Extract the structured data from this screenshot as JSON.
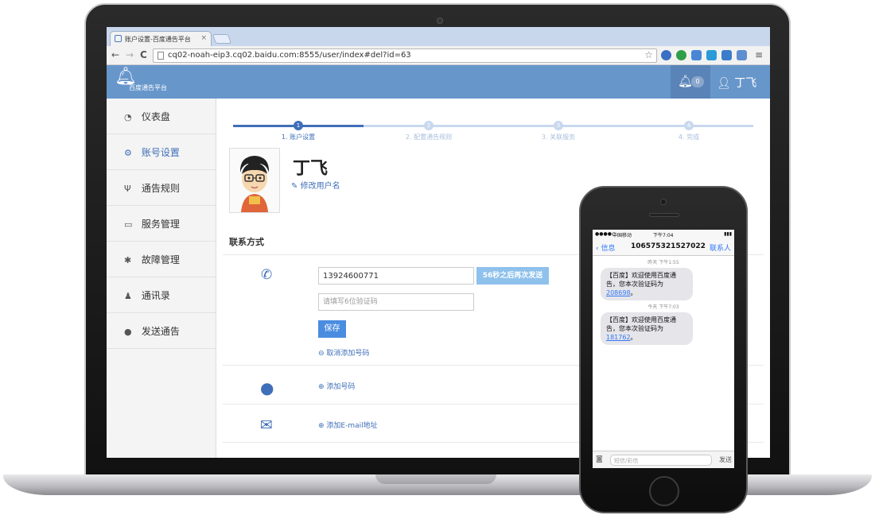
{
  "browser": {
    "tab_title": "账户设置-百度通告平台",
    "tab_close": "×",
    "url": "cq02-noah-eip3.cq02.baidu.com:8555/user/index#del?id=63",
    "nav_back": "←",
    "nav_forward": "→",
    "nav_reload": "C",
    "star": "☆"
  },
  "header": {
    "logo_text": "百度通告平台",
    "notification_count": "0",
    "user_name": "丁飞"
  },
  "sidebar": {
    "items": [
      {
        "label": "仪表盘",
        "icon": "dashboard-icon"
      },
      {
        "label": "账号设置",
        "icon": "cogs-icon"
      },
      {
        "label": "通告规则",
        "icon": "cutlery-icon"
      },
      {
        "label": "服务管理",
        "icon": "inbox-icon"
      },
      {
        "label": "故障管理",
        "icon": "bug-icon"
      },
      {
        "label": "通讯录",
        "icon": "users-icon"
      },
      {
        "label": "发送通告",
        "icon": "comment-icon"
      }
    ],
    "active_index": 1
  },
  "steps": [
    {
      "label": "1. 账户设置",
      "num": "1"
    },
    {
      "label": "2. 配置通告规则",
      "num": "2"
    },
    {
      "label": "3. 关联服务",
      "num": "3"
    },
    {
      "label": "4. 完成",
      "num": "4"
    }
  ],
  "profile": {
    "name": "丁飞",
    "edit_name": "修改用户名"
  },
  "contact": {
    "section_title": "联系方式",
    "phone_value": "13924600771",
    "resend_label": "56秒之后再次发送",
    "code_placeholder": "请填写6位验证码",
    "save_label": "保存",
    "cancel_add_phone": "取消添加号码",
    "add_number": "添加号码",
    "add_email": "添加E-mail地址"
  },
  "phone": {
    "carrier": "中国移动",
    "status_time": "下午7:04",
    "back_label": "信息",
    "sender": "106575321527022",
    "contacts_label": "联系人",
    "messages": [
      {
        "time": "昨天 下午1:55",
        "text": "【百度】欢迎使用百度通告，您本次验证码为",
        "code": "208698"
      },
      {
        "time": "今天 下午7:03",
        "text": "【百度】欢迎使用百度通告，您本次验证码为",
        "code": "181762"
      }
    ],
    "input_placeholder": "短信/彩信",
    "send_label": "发送"
  },
  "colors": {
    "header_bg": "#6796cb",
    "accent": "#3f6fb8",
    "resend_bg": "#8ec1ec",
    "save_bg": "#4a8de0"
  }
}
